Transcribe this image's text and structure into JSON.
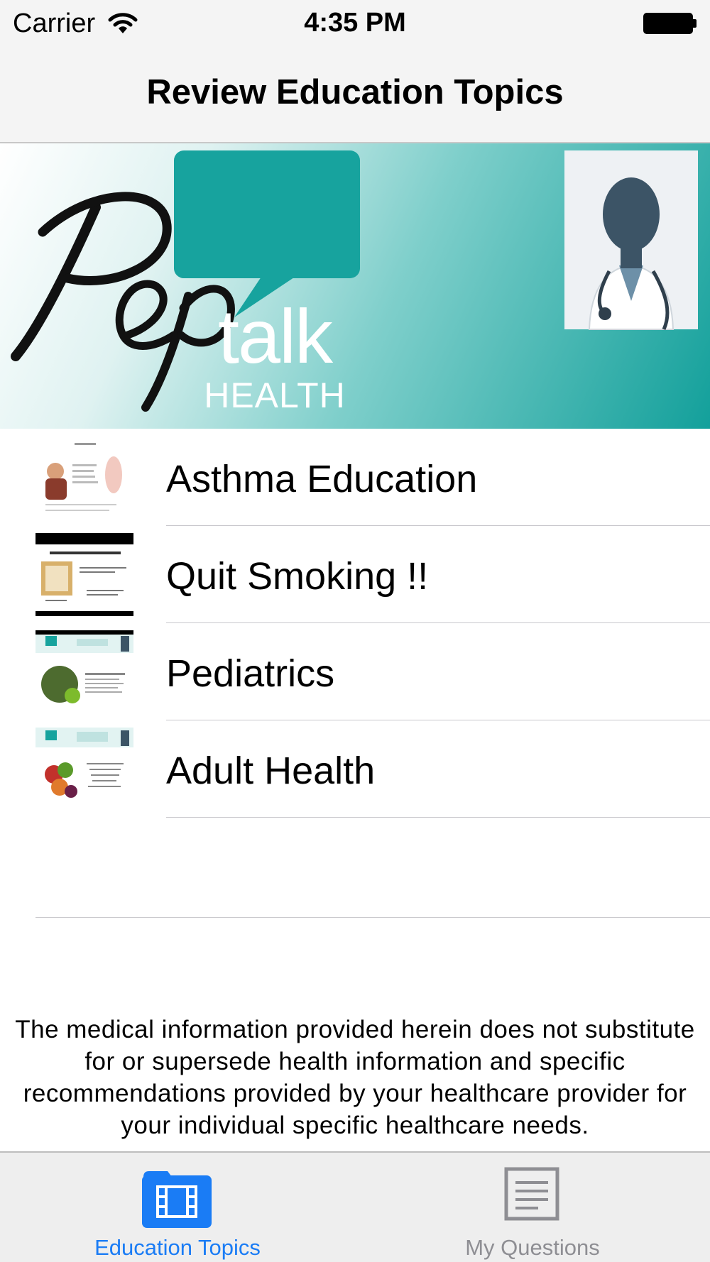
{
  "status_bar": {
    "carrier": "Carrier",
    "time": "4:35 PM"
  },
  "nav": {
    "title": "Review Education Topics"
  },
  "banner": {
    "logo_script": "Pep",
    "logo_talk": "talk",
    "logo_health": "HEALTH"
  },
  "topics": [
    {
      "label": "Asthma Education",
      "thumbnail": "asthma-symptoms-slide"
    },
    {
      "label": "Quit Smoking !!",
      "thumbnail": "quit-smoking-slide"
    },
    {
      "label": "Pediatrics",
      "thumbnail": "wellness-slide"
    },
    {
      "label": "Adult Health",
      "thumbnail": "blood-pressure-slide"
    }
  ],
  "disclaimer": "The medical information provided herein does not substitute for or supersede health information and specific recommendations provided by your healthcare provider for your individual specific healthcare needs.",
  "tabs": [
    {
      "label": "Education Topics",
      "icon": "film-folder-icon",
      "selected": true
    },
    {
      "label": "My Questions",
      "icon": "document-icon",
      "selected": false
    }
  ],
  "colors": {
    "accent": "#1a7cf5",
    "inactive_tab": "#8e8e93",
    "banner_teal": "#13a09b",
    "logo_bubble": "#17a39e"
  }
}
